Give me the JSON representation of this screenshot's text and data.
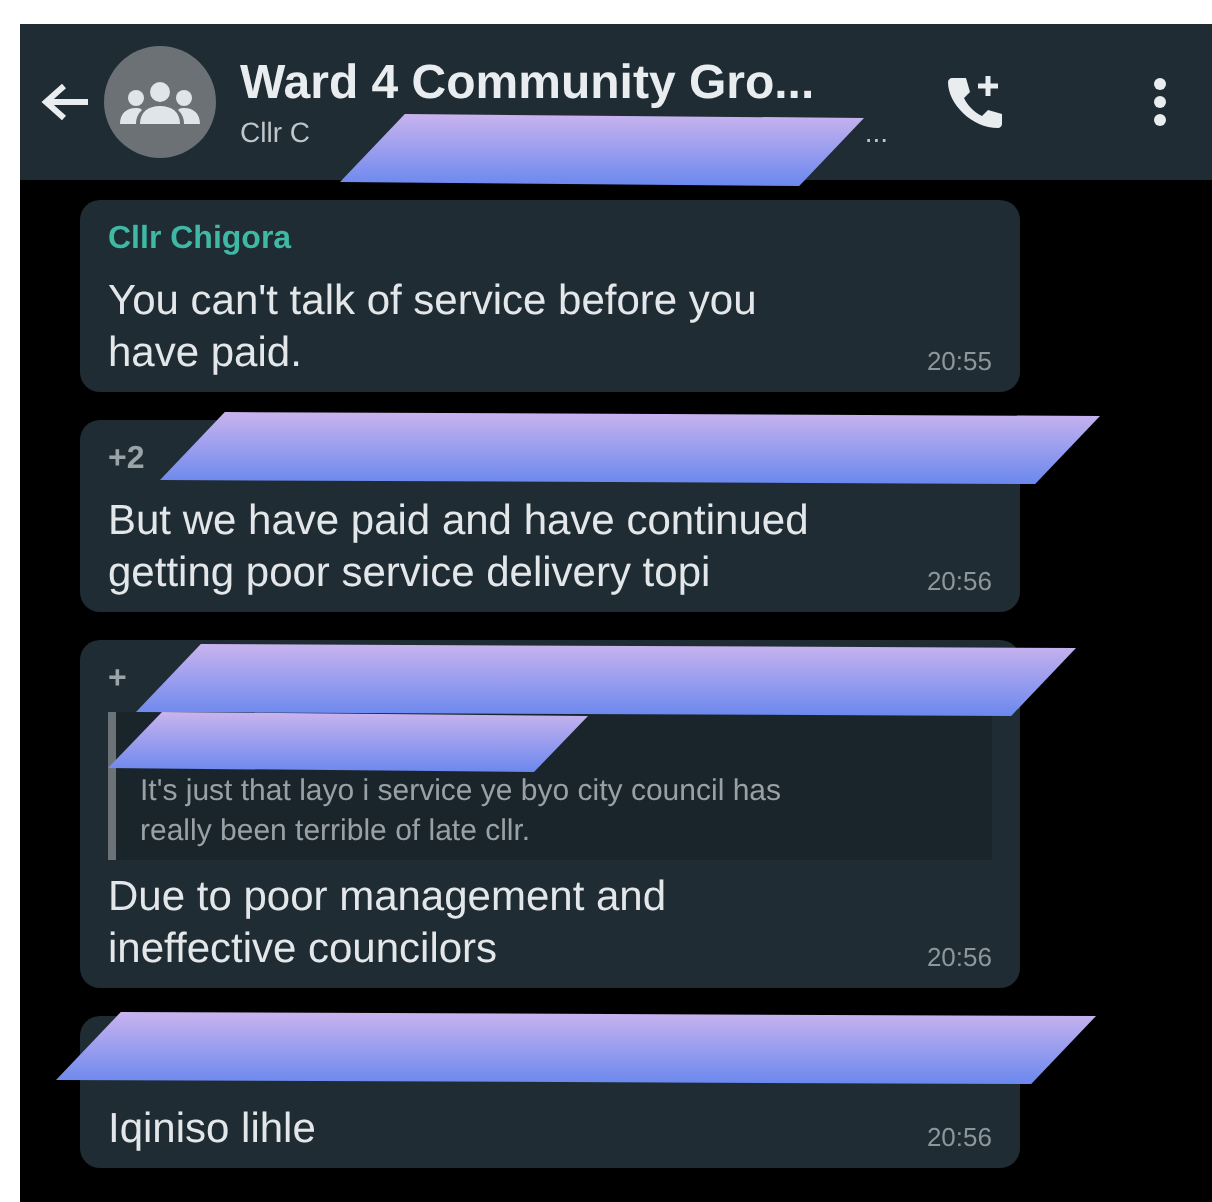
{
  "header": {
    "title": "Ward 4 Community Gro...",
    "subtitle_start": "Cllr C",
    "subtitle_end": "..."
  },
  "messages": [
    {
      "sender": "Cllr Chigora",
      "color": "#3fb8a5",
      "text": "You can't talk of service before you have paid.",
      "time": "20:55"
    },
    {
      "sender": "+2",
      "color": "#9aa3a8",
      "text": "But we have paid and have continued getting poor service delivery topi",
      "time": "20:56"
    },
    {
      "sender": "+",
      "color": "#9aa3a8",
      "quote": "It's just that layo i service ye byo  city council has really been terrible of late cllr.",
      "text": "Due to poor management and ineffective councilors",
      "time": "20:56"
    },
    {
      "text": "Iqiniso lihle",
      "time": "20:56"
    }
  ]
}
